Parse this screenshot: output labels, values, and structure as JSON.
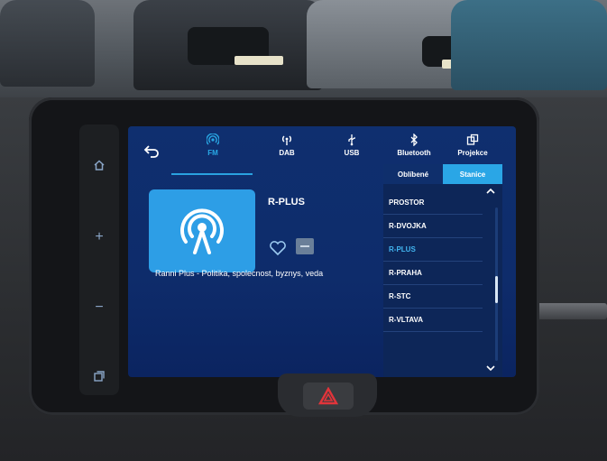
{
  "colors": {
    "accent": "#29a9e6",
    "screen_bg": "#0e2c6b",
    "logo_tile": "#2d9ee6",
    "active_list_text": "#42b5f0"
  },
  "side_panel": {
    "buttons": [
      {
        "icon": "home-icon"
      },
      {
        "icon": "plus-icon",
        "label": "+"
      },
      {
        "icon": "minus-icon",
        "label": "−"
      },
      {
        "icon": "apps-icon"
      }
    ]
  },
  "topbar": {
    "back_icon": "back-arrow-icon",
    "tabs": [
      {
        "label": "FM",
        "icon": "radio-waves-icon",
        "active": true
      },
      {
        "label": "DAB",
        "icon": "dab-signal-icon",
        "active": false
      },
      {
        "label": "USB",
        "icon": "usb-icon",
        "active": false
      },
      {
        "label": "Bluetooth",
        "icon": "bluetooth-icon",
        "active": false
      },
      {
        "label": "Projekce",
        "icon": "projection-icon",
        "active": false
      }
    ]
  },
  "now_playing": {
    "station": "R-PLUS",
    "rds": "Ranni Plus - Politika, spolecnost, byznys, veda",
    "logo_icon": "radio-tower-icon",
    "favorite_icon": "heart-icon",
    "info_icon": "info-bar-icon"
  },
  "station_list": {
    "tabs": [
      {
        "label": "Oblíbené",
        "active": false
      },
      {
        "label": "Stanice",
        "active": true
      }
    ],
    "items": [
      {
        "label": "PROSTOR",
        "active": false
      },
      {
        "label": "R-DVOJKA",
        "active": false
      },
      {
        "label": "R-PLUS",
        "active": true
      },
      {
        "label": "R-PRAHA",
        "active": false
      },
      {
        "label": "R-STC",
        "active": false
      },
      {
        "label": "R-VLTAVA",
        "active": false
      }
    ],
    "scroll_up_icon": "chevron-up-icon",
    "scroll_down_icon": "chevron-down-icon"
  },
  "hazard": {
    "icon": "hazard-triangle-icon"
  }
}
